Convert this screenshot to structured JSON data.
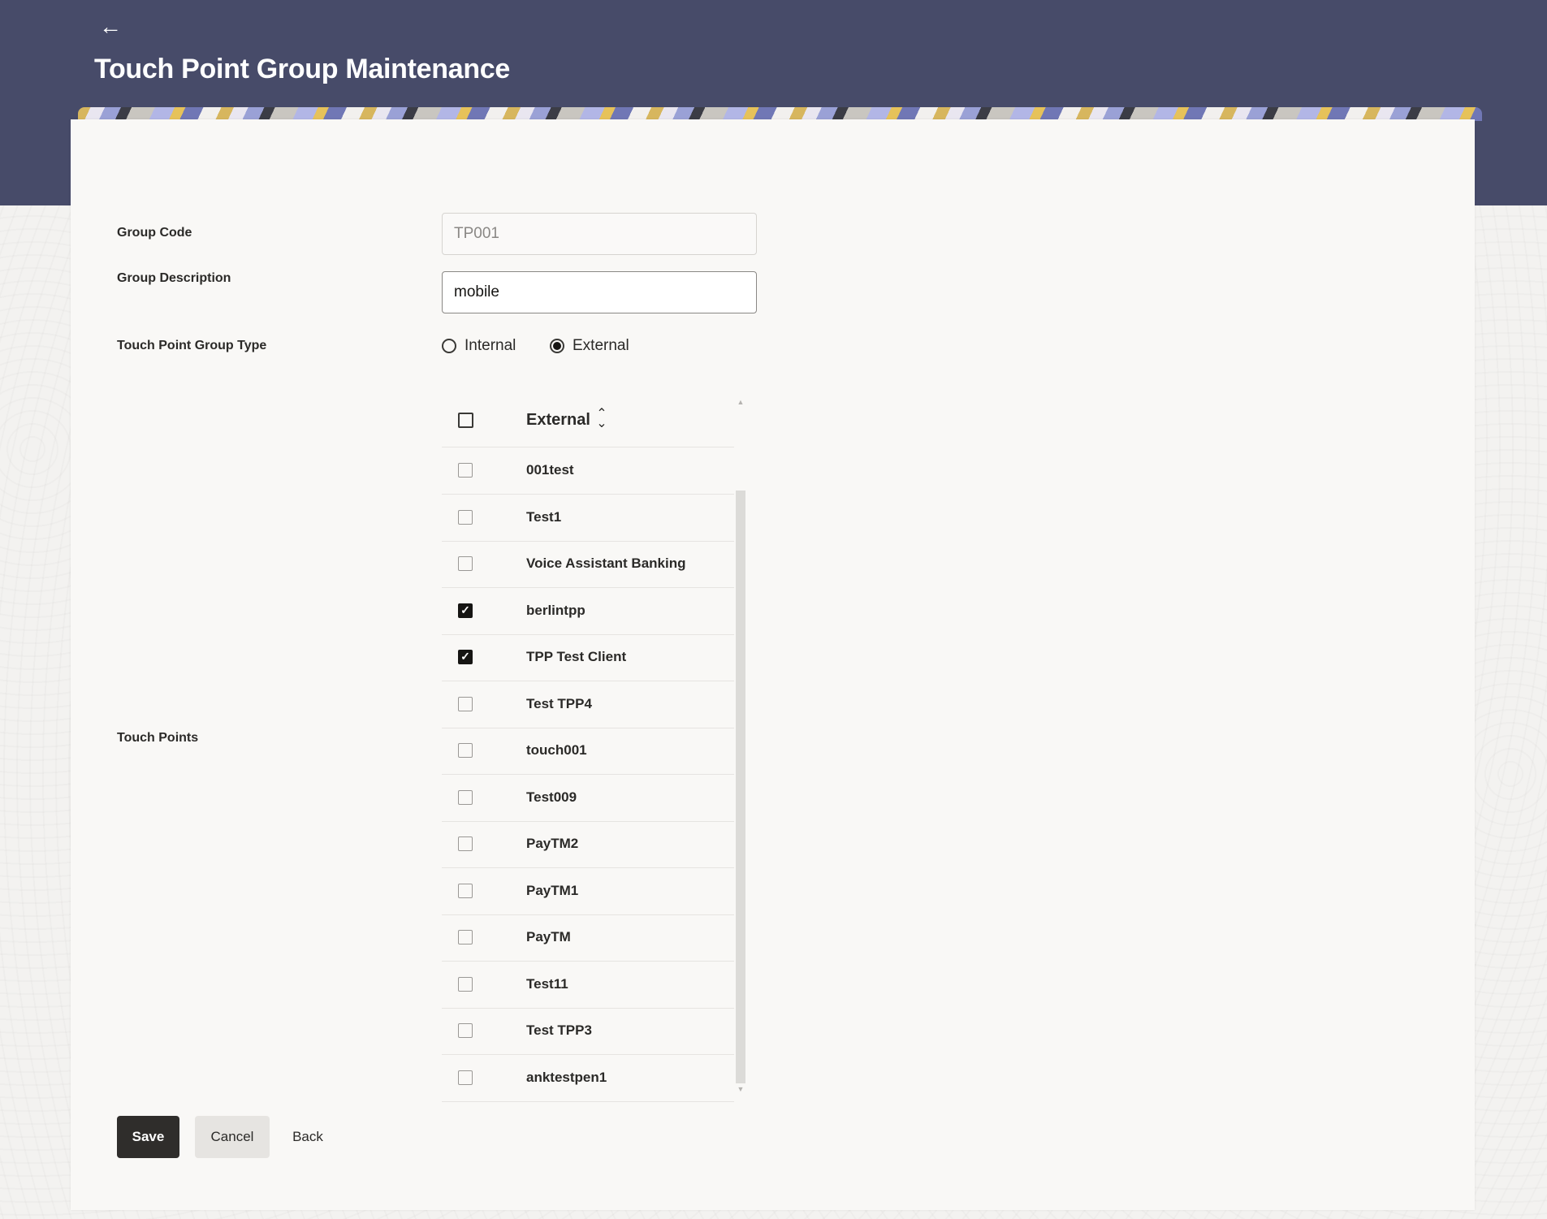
{
  "header": {
    "title": "Touch Point Group Maintenance",
    "back_icon": "arrow-left-icon"
  },
  "form": {
    "group_code_label": "Group Code",
    "group_code_value": "TP001",
    "group_description_label": "Group Description",
    "group_description_value": "mobile",
    "group_type_label": "Touch Point Group Type",
    "group_type_options": [
      {
        "label": "Internal",
        "selected": false
      },
      {
        "label": "External",
        "selected": true
      }
    ],
    "touch_points_label": "Touch Points"
  },
  "table": {
    "column_header": "External",
    "rows": [
      {
        "name": "001test",
        "checked": false
      },
      {
        "name": "Test1",
        "checked": false
      },
      {
        "name": "Voice Assistant Banking",
        "checked": false
      },
      {
        "name": "berlintpp",
        "checked": true
      },
      {
        "name": "TPP Test Client",
        "checked": true
      },
      {
        "name": "Test TPP4",
        "checked": false
      },
      {
        "name": "touch001",
        "checked": false
      },
      {
        "name": "Test009",
        "checked": false
      },
      {
        "name": "PayTM2",
        "checked": false
      },
      {
        "name": "PayTM1",
        "checked": false
      },
      {
        "name": "PayTM",
        "checked": false
      },
      {
        "name": "Test11",
        "checked": false
      },
      {
        "name": "Test TPP3",
        "checked": false
      },
      {
        "name": "anktestpen1",
        "checked": false
      }
    ]
  },
  "actions": {
    "save": "Save",
    "cancel": "Cancel",
    "back": "Back"
  },
  "colors": {
    "header_bg": "#474b69",
    "primary_button": "#2f2d2b",
    "card_bg": "#f9f8f6"
  }
}
